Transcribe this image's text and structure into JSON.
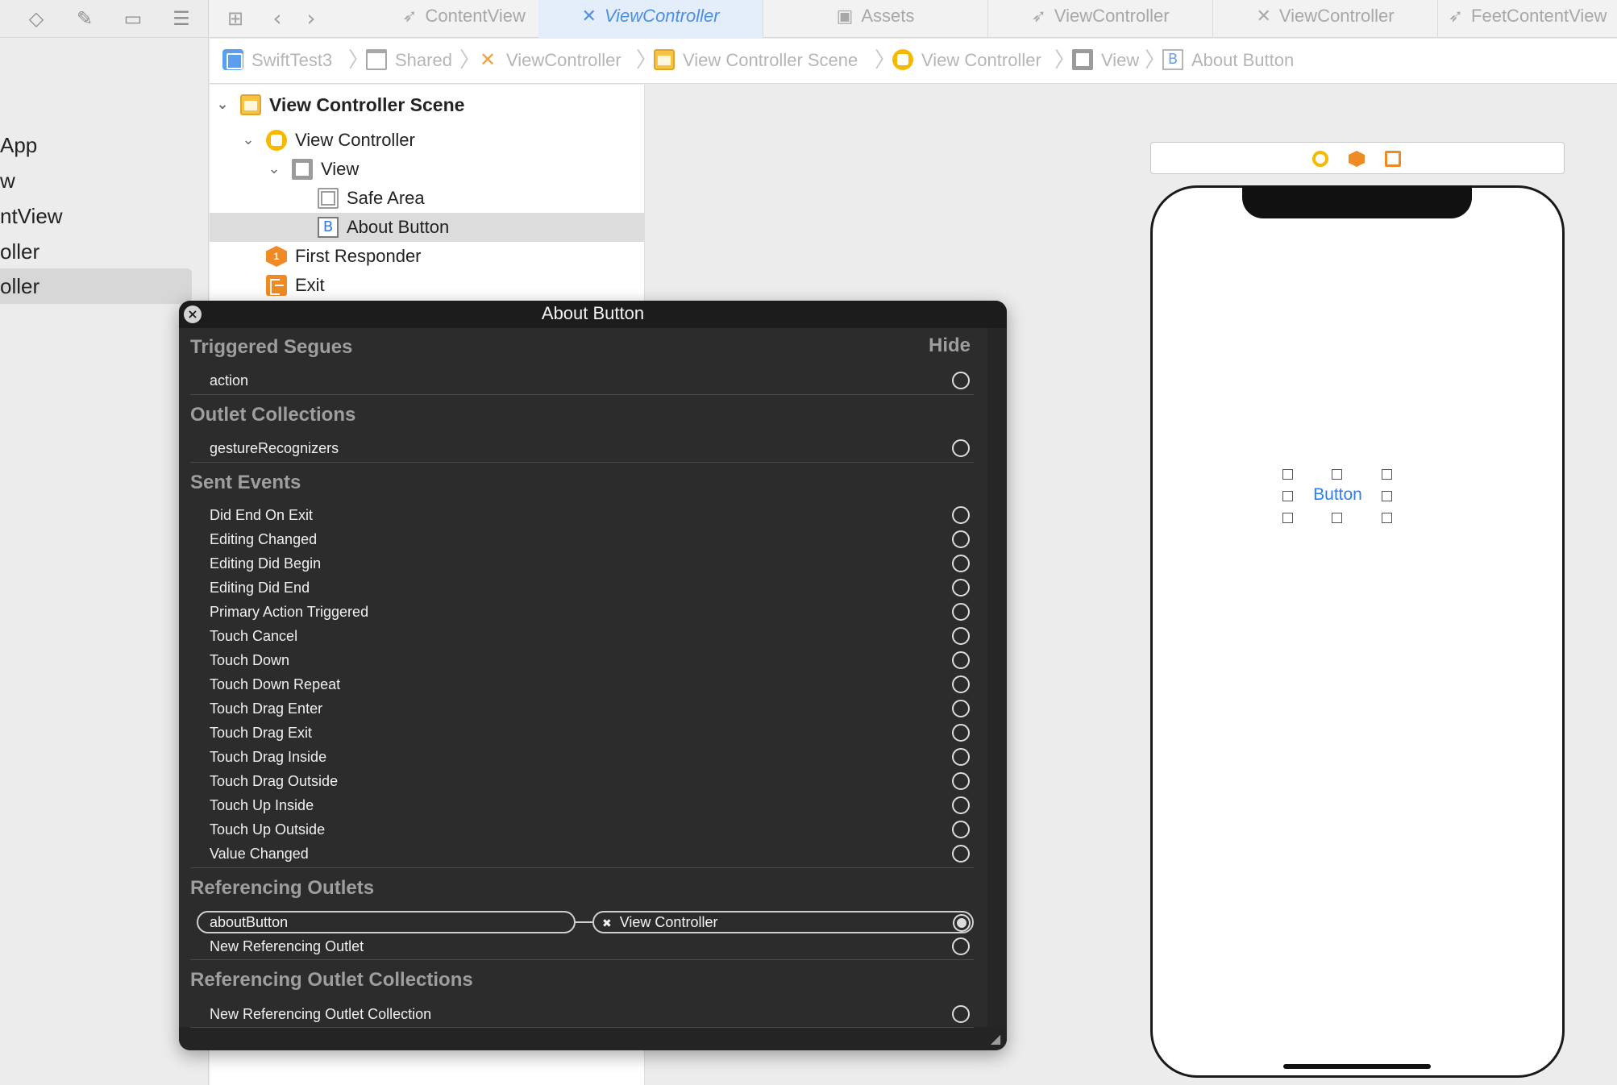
{
  "navigator": {
    "toolbar_icons": [
      "diamond-icon",
      "paint-spray-icon",
      "label-icon",
      "list-icon"
    ],
    "files": [
      "App",
      "w",
      "ntView",
      "oller",
      "oller"
    ],
    "selected_index": 4
  },
  "tabbar": {
    "tabs": [
      {
        "label": "ContentView",
        "icon": "swift-icon"
      },
      {
        "label": "ViewController",
        "icon": "storyboard-icon",
        "active": true
      },
      {
        "label": "Assets",
        "icon": "assets-icon"
      },
      {
        "label": "ViewController",
        "icon": "swift-icon"
      },
      {
        "label": "ViewController",
        "icon": "storyboard-icon"
      },
      {
        "label": "FeetContentView",
        "icon": "swift-icon"
      }
    ]
  },
  "breadcrumb": [
    "SwiftTest3",
    "Shared",
    "ViewController",
    "View Controller Scene",
    "View Controller",
    "View",
    "About Button"
  ],
  "outline": {
    "rows": [
      {
        "label": "View Controller Scene"
      },
      {
        "label": "View Controller"
      },
      {
        "label": "View"
      },
      {
        "label": "Safe Area"
      },
      {
        "label": "About Button"
      },
      {
        "label": "First Responder"
      },
      {
        "label": "Exit"
      }
    ],
    "button_glyph": "B",
    "first_responder_glyph": "1"
  },
  "canvas": {
    "button_label": "Button"
  },
  "hud": {
    "title": "About Button",
    "hide_label": "Hide",
    "sections": {
      "triggered_segues": {
        "title": "Triggered Segues",
        "items": [
          "action"
        ]
      },
      "outlet_collections": {
        "title": "Outlet Collections",
        "items": [
          "gestureRecognizers"
        ]
      },
      "sent_events": {
        "title": "Sent Events",
        "items": [
          "Did End On Exit",
          "Editing Changed",
          "Editing Did Begin",
          "Editing Did End",
          "Primary Action Triggered",
          "Touch Cancel",
          "Touch Down",
          "Touch Down Repeat",
          "Touch Drag Enter",
          "Touch Drag Exit",
          "Touch Drag Inside",
          "Touch Drag Outside",
          "Touch Up Inside",
          "Touch Up Outside",
          "Value Changed"
        ]
      },
      "referencing_outlets": {
        "title": "Referencing Outlets",
        "outlet_name": "aboutButton",
        "target": "View Controller",
        "new_item": "New Referencing Outlet"
      },
      "referencing_outlet_collections": {
        "title": "Referencing Outlet Collections",
        "new_item": "New Referencing Outlet Collection"
      }
    }
  }
}
